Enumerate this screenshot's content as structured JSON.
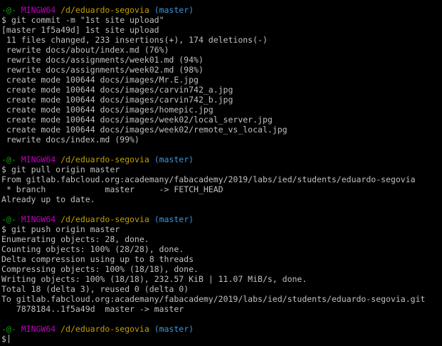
{
  "prompt": {
    "user": "-@-",
    "system": "MINGW64",
    "path": "/d/eduardo-segovia",
    "branch": "(master)",
    "symbol": "$"
  },
  "colors": {
    "background": "#000000",
    "text": "#c0c0c0",
    "user": "#13a10e",
    "system": "#c000c0",
    "path": "#c0a000",
    "branch": "#3a96dd"
  },
  "blocks": [
    {
      "command": "git commit -m \"1st site upload\"",
      "output": [
        "[master 1f5a49d] 1st site upload",
        " 11 files changed, 233 insertions(+), 174 deletions(-)",
        " rewrite docs/about/index.md (76%)",
        " rewrite docs/assignments/week01.md (94%)",
        " rewrite docs/assignments/week02.md (98%)",
        " create mode 100644 docs/images/Mr.E.jpg",
        " create mode 100644 docs/images/carvin742_a.jpg",
        " create mode 100644 docs/images/carvin742_b.jpg",
        " create mode 100644 docs/images/homepic.jpg",
        " create mode 100644 docs/images/week02/local_server.jpg",
        " create mode 100644 docs/images/week02/remote_vs_local.jpg",
        " rewrite docs/index.md (99%)"
      ]
    },
    {
      "command": "git pull origin master",
      "output": [
        "From gitlab.fabcloud.org:academany/fabacademy/2019/labs/ied/students/eduardo-segovia",
        " * branch            master     -> FETCH_HEAD",
        "Already up to date."
      ]
    },
    {
      "command": "git push origin master",
      "output": [
        "Enumerating objects: 28, done.",
        "Counting objects: 100% (28/28), done.",
        "Delta compression using up to 8 threads",
        "Compressing objects: 100% (18/18), done.",
        "Writing objects: 100% (18/18), 232.57 KiB | 11.07 MiB/s, done.",
        "Total 18 (delta 3), reused 0 (delta 0)",
        "To gitlab.fabcloud.org:academany/fabacademy/2019/labs/ied/students/eduardo-segovia.git",
        "   7878184..1f5a49d  master -> master"
      ]
    }
  ]
}
